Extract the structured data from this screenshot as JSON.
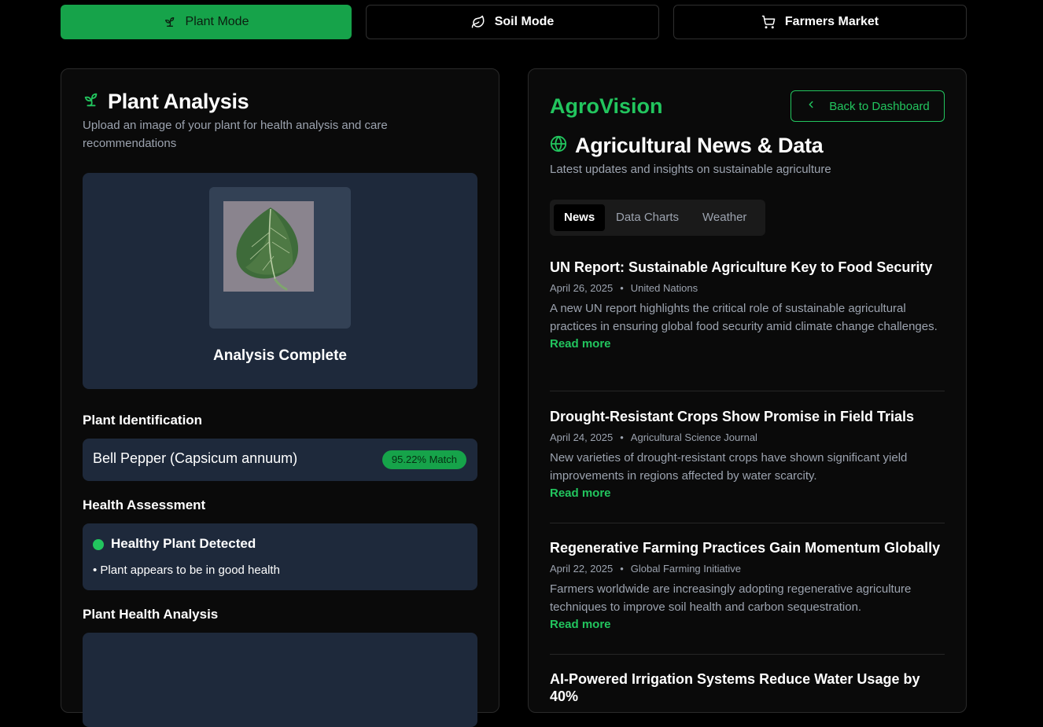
{
  "modes": {
    "plant": "Plant Mode",
    "soil": "Soil Mode",
    "market": "Farmers Market"
  },
  "plant_analysis": {
    "title": "Plant Analysis",
    "subtitle": "Upload an image of your plant for health analysis and care recommendations",
    "status": "Analysis Complete",
    "identification_heading": "Plant Identification",
    "plant_name": "Bell Pepper (Capsicum annuum)",
    "match": "95.22% Match",
    "health_heading": "Health Assessment",
    "health_status": "Healthy Plant Detected",
    "health_note": "• Plant appears to be in good health",
    "analysis_heading": "Plant Health Analysis"
  },
  "right": {
    "brand": "AgroVision",
    "back_label": "Back to Dashboard",
    "title": "Agricultural News & Data",
    "subtitle": "Latest updates and insights on sustainable agriculture",
    "tabs": [
      "News",
      "Data Charts",
      "Weather"
    ],
    "articles": [
      {
        "title": "UN Report: Sustainable Agriculture Key to Food Security",
        "date": "April 26, 2025",
        "source": "United Nations",
        "summary": "A new UN report highlights the critical role of sustainable agricultural practices in ensuring global food security amid climate change challenges.",
        "link": "Read more"
      },
      {
        "title": "Drought-Resistant Crops Show Promise in Field Trials",
        "date": "April 24, 2025",
        "source": "Agricultural Science Journal",
        "summary": "New varieties of drought-resistant crops have shown significant yield improvements in regions affected by water scarcity.",
        "link": "Read more"
      },
      {
        "title": "Regenerative Farming Practices Gain Momentum Globally",
        "date": "April 22, 2025",
        "source": "Global Farming Initiative",
        "summary": "Farmers worldwide are increasingly adopting regenerative agriculture techniques to improve soil health and carbon sequestration.",
        "link": "Read more"
      },
      {
        "title": "AI-Powered Irrigation Systems Reduce Water Usage by 40%"
      }
    ]
  },
  "colors": {
    "accent": "#22c55e",
    "accent_button": "#16a34a",
    "panel": "#1e293b",
    "background": "#000000"
  },
  "icons": {
    "plant": "sprout-icon",
    "soil": "leaf-icon",
    "market": "shopping-cart-icon",
    "back": "chevron-left-icon",
    "news": "globe-icon"
  }
}
